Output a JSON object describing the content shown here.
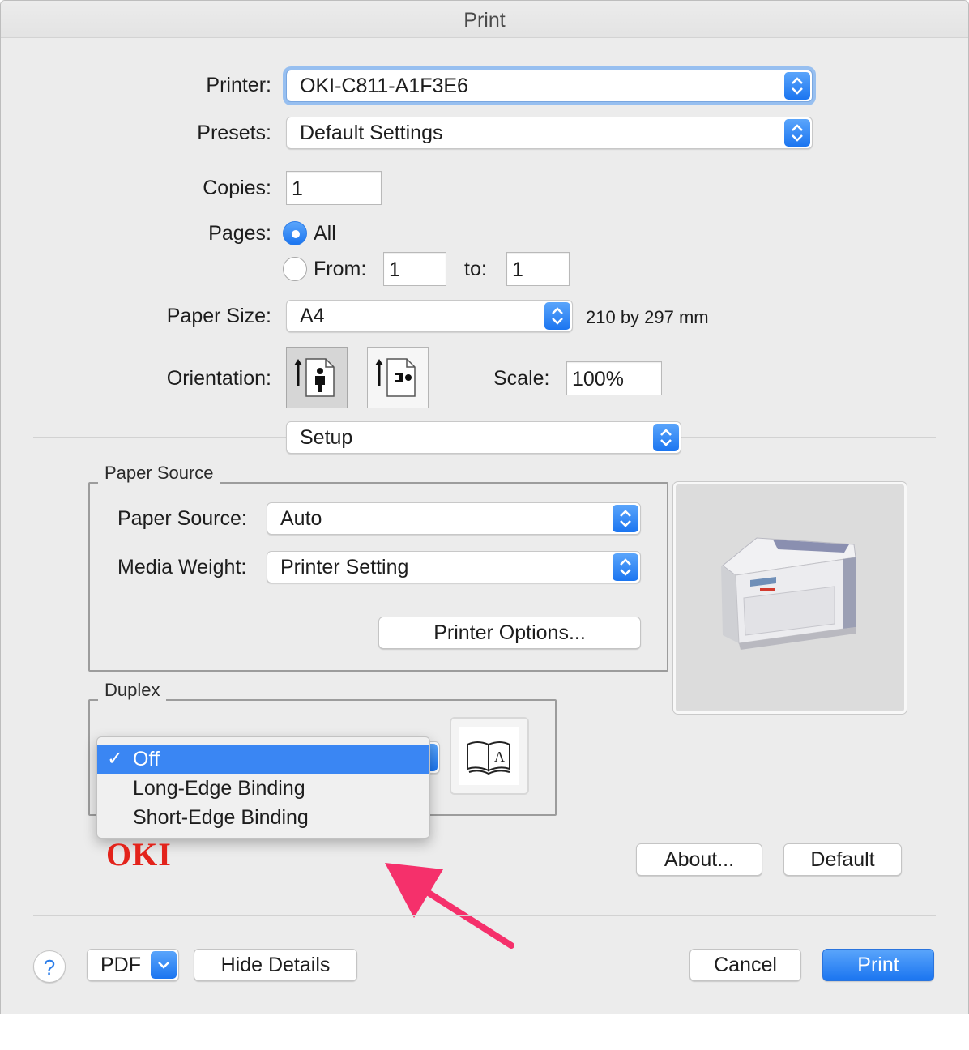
{
  "window": {
    "title": "Print"
  },
  "printer": {
    "label": "Printer:",
    "value": "OKI-C811-A1F3E6"
  },
  "presets": {
    "label": "Presets:",
    "value": "Default Settings"
  },
  "copies": {
    "label": "Copies:",
    "value": "1"
  },
  "pages": {
    "label": "Pages:",
    "all_label": "All",
    "from_label": "From:",
    "from_value": "1",
    "to_label": "to:",
    "to_value": "1",
    "selected": "All"
  },
  "paper_size": {
    "label": "Paper Size:",
    "value": "A4",
    "dimensions": "210 by 297 mm"
  },
  "orientation": {
    "label": "Orientation:",
    "selected": "portrait"
  },
  "scale": {
    "label": "Scale:",
    "value": "100%"
  },
  "section_popup": {
    "value": "Setup"
  },
  "paper_source_group": {
    "legend": "Paper Source",
    "source_label": "Paper Source:",
    "source_value": "Auto",
    "media_weight_label": "Media Weight:",
    "media_weight_value": "Printer Setting",
    "options_button": "Printer Options..."
  },
  "duplex_group": {
    "legend": "Duplex",
    "menu": [
      {
        "label": "Off",
        "checked": true
      },
      {
        "label": "Long-Edge Binding",
        "checked": false
      },
      {
        "label": "Short-Edge Binding",
        "checked": false
      }
    ],
    "check_mark": "✓"
  },
  "brand": {
    "logo_text": "OKI",
    "color": "#e3231b"
  },
  "buttons": {
    "about": "About...",
    "default": "Default",
    "help": "?",
    "pdf": "PDF",
    "hide_details": "Hide Details",
    "cancel": "Cancel",
    "print": "Print"
  },
  "colors": {
    "accent": "#1b75f0",
    "annotation_arrow": "#f5306b"
  },
  "icons": {
    "stepper": "up-down-chevron-icon",
    "portrait": "portrait-orientation-icon",
    "landscape": "landscape-orientation-icon",
    "printer": "printer-image",
    "booklet": "open-book-icon",
    "pdf_menu": "chevron-down-icon",
    "annotation": "pink-arrow-icon"
  }
}
